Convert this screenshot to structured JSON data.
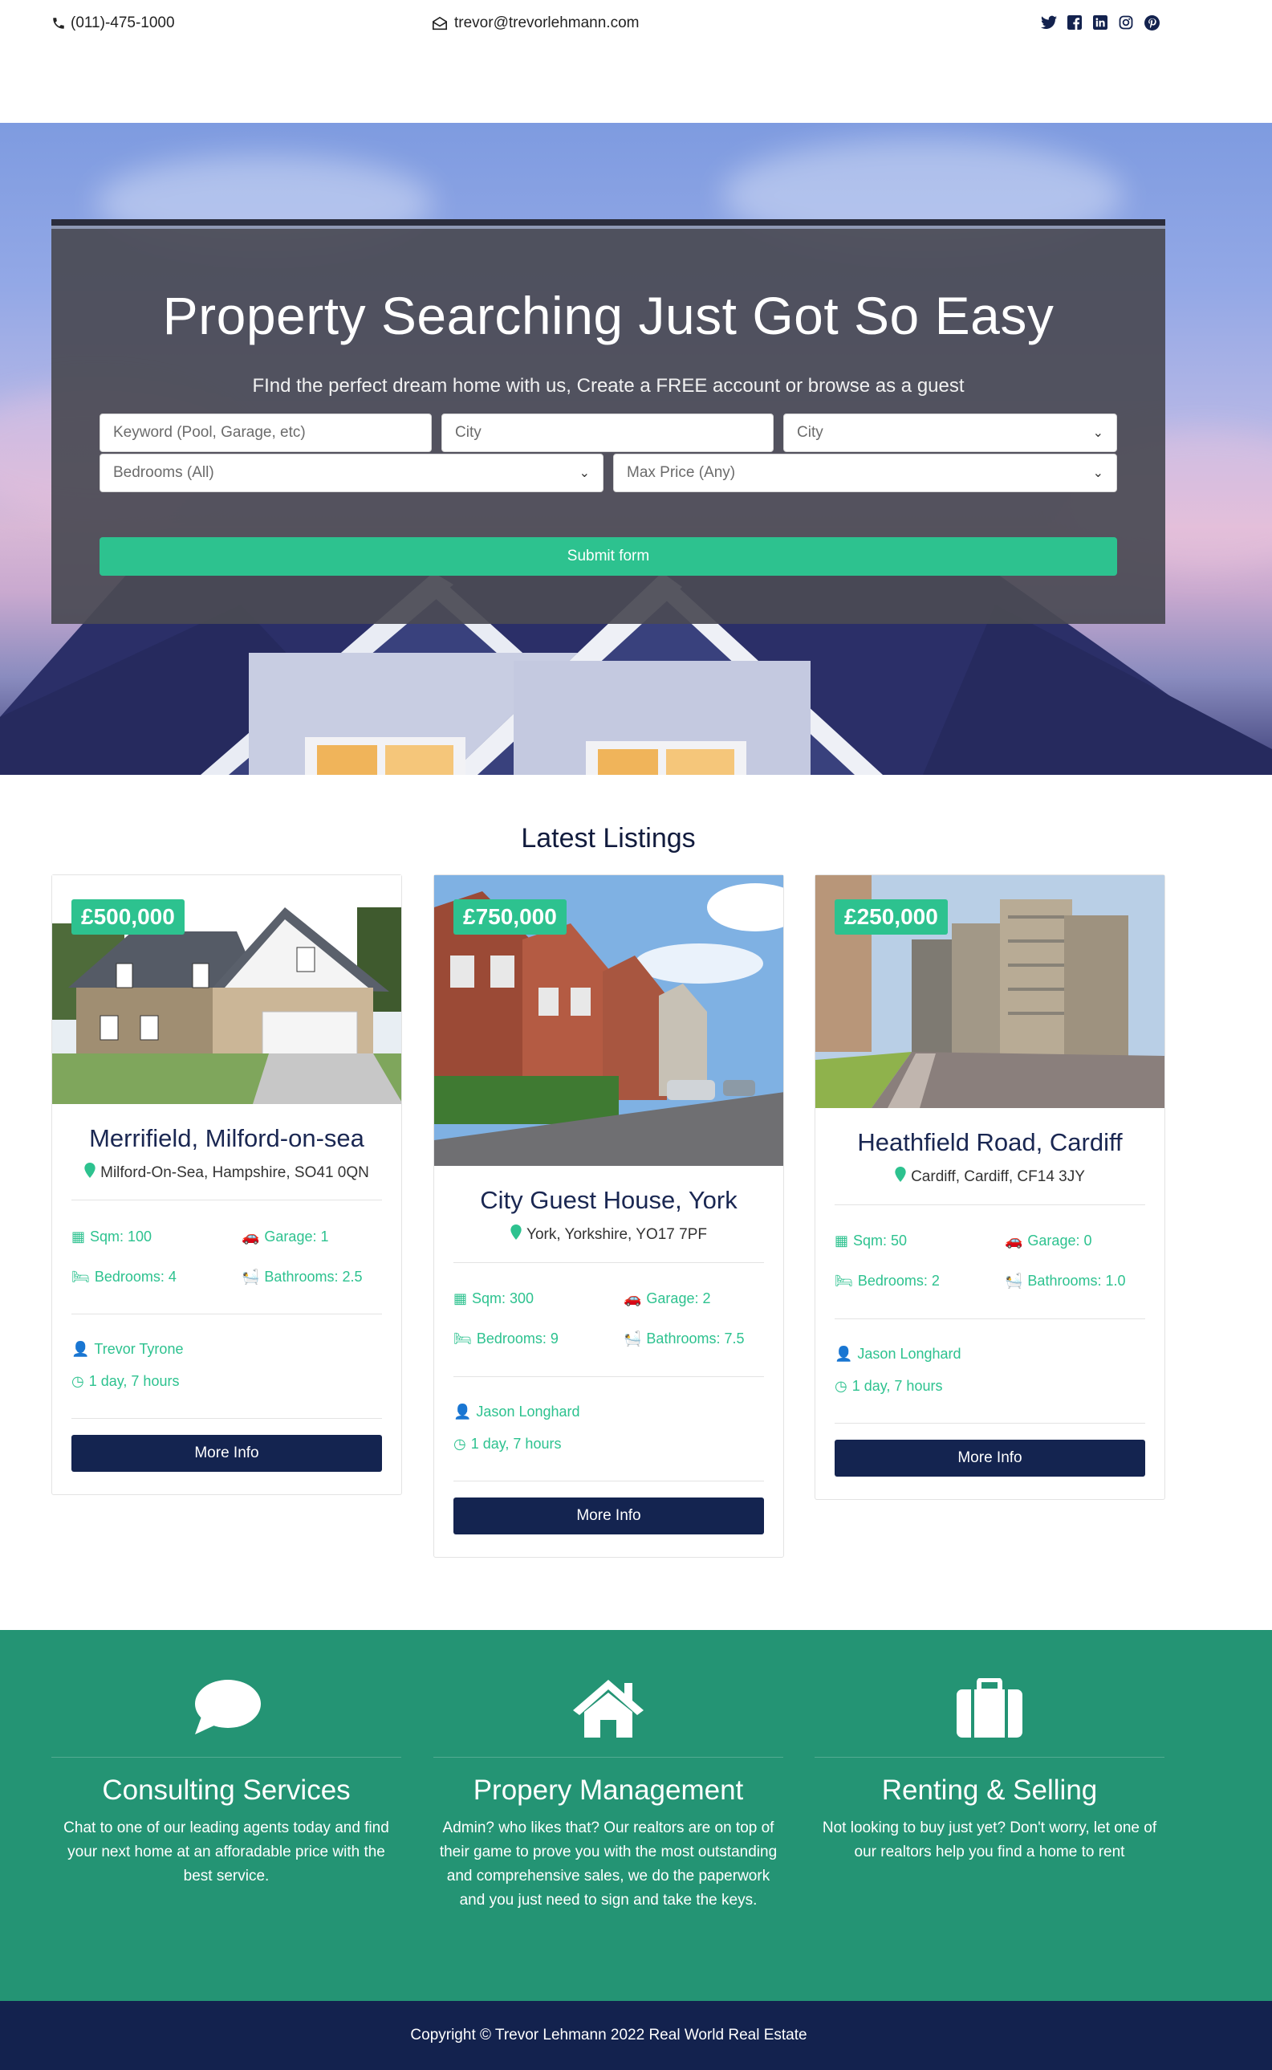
{
  "topbar": {
    "phone": "(011)-475-1000",
    "email": "trevor@trevorlehmann.com",
    "social_icons": [
      "twitter-icon",
      "facebook-icon",
      "linkedin-icon",
      "instagram-icon",
      "pinterest-icon"
    ],
    "icon_color": "#13224e"
  },
  "hero": {
    "title": "Property Searching Just Got So Easy",
    "subtitle": "FInd the perfect dream home with us, Create a FREE account or browse as a guest",
    "keyword_placeholder": "Keyword (Pool, Garage, etc)",
    "city_placeholder": "City",
    "city_select": "City",
    "bedrooms_select": "Bedrooms (All)",
    "price_select": "Max Price (Any)",
    "submit_label": "Submit form"
  },
  "listings": {
    "title": "Latest Listings",
    "more_info_label": "More Info",
    "items": [
      {
        "price": "£500,000",
        "title": "Merrifield, Milford-on-sea",
        "address": "Milford-On-Sea, Hampshire, SO41 0QN",
        "sqm": "Sqm: 100",
        "garage": "Garage: 1",
        "bedrooms": "Bedrooms: 4",
        "bathrooms": "Bathrooms: 2.5",
        "agent": "Trevor Tyrone",
        "time": "1 day, 7 hours"
      },
      {
        "price": "£750,000",
        "title": "City Guest House, York",
        "address": "York, Yorkshire, YO17 7PF",
        "sqm": "Sqm: 300",
        "garage": "Garage: 2",
        "bedrooms": "Bedrooms: 9",
        "bathrooms": "Bathrooms: 7.5",
        "agent": "Jason Longhard",
        "time": "1 day, 7 hours"
      },
      {
        "price": "£250,000",
        "title": "Heathfield Road, Cardiff",
        "address": "Cardiff, Cardiff, CF14 3JY",
        "sqm": "Sqm: 50",
        "garage": "Garage: 0",
        "bedrooms": "Bedrooms: 2",
        "bathrooms": "Bathrooms: 1.0",
        "agent": "Jason Longhard",
        "time": "1 day, 7 hours"
      }
    ]
  },
  "services": [
    {
      "icon": "chat-bubble-icon",
      "title": "Consulting Services",
      "text": "Chat to one of our leading agents today and find your next home at an afforadable price with the best service."
    },
    {
      "icon": "home-icon",
      "title": "Propery Management",
      "text": "Admin? who likes that? Our realtors are on top of their game to prove you with the most outstanding and comprehensive sales, we do the paperwork and you just need to sign and take the keys."
    },
    {
      "icon": "suitcase-icon",
      "title": "Renting & Selling",
      "text": "Not looking to buy just yet? Don't worry, let one of our realtors help you find a home to rent"
    }
  ],
  "footer": {
    "copyright": "Copyright © Trevor Lehmann 2022 Real World Real Estate"
  },
  "colors": {
    "accent": "#2dc28f",
    "navy": "#13224e",
    "services_bg": "#249474"
  }
}
